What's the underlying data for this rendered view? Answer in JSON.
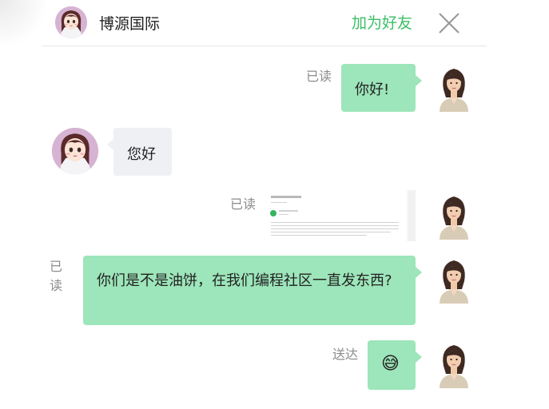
{
  "header": {
    "contact_name": "博源国际",
    "add_friend_label": "加为好友",
    "close_icon": "close-icon"
  },
  "messages": [
    {
      "side": "right",
      "type": "text",
      "text": "你好!",
      "status": "已读"
    },
    {
      "side": "left",
      "type": "text",
      "text": "您好"
    },
    {
      "side": "right",
      "type": "image",
      "status": "已读"
    },
    {
      "side": "right",
      "type": "text",
      "text": "你们是不是油饼，在我们编程社区一直发东西?",
      "status": "已\n读"
    },
    {
      "side": "right",
      "type": "emoji",
      "emoji": "😅",
      "status": "送达"
    }
  ],
  "colors": {
    "accent_green": "#3cbf66",
    "sent_bubble": "#9de5ba",
    "received_bubble": "#eef0f4",
    "status_gray": "#8c8c8c"
  }
}
